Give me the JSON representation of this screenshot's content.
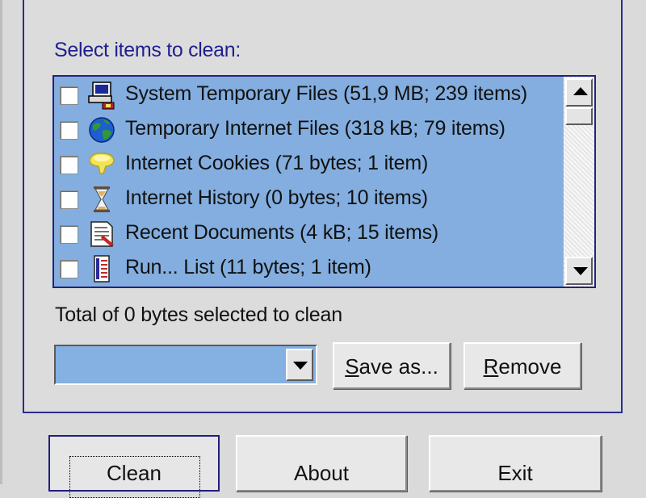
{
  "cleaner": {
    "section_label": "Select items to clean:",
    "items": [
      {
        "label": "System Temporary Files (51,9 MB; 239 items)",
        "icon": "computer-icon",
        "checked": false
      },
      {
        "label": "Temporary Internet Files (318 kB; 79 items)",
        "icon": "globe-icon",
        "checked": false
      },
      {
        "label": "Internet Cookies (71 bytes; 1 item)",
        "icon": "cookie-icon",
        "checked": false
      },
      {
        "label": "Internet History (0 bytes; 10 items)",
        "icon": "hourglass-icon",
        "checked": false
      },
      {
        "label": "Recent Documents (4 kB; 15 items)",
        "icon": "documents-icon",
        "checked": false
      },
      {
        "label": "Run... List (11 bytes; 1 item)",
        "icon": "run-list-icon",
        "checked": false
      }
    ],
    "total_text": "Total of 0 bytes selected to clean",
    "profile_value": "",
    "save_as": {
      "prefix": "S",
      "rest": "ave as..."
    },
    "remove": {
      "prefix": "R",
      "rest": "emove"
    }
  },
  "footer": {
    "clean_label": "Clean",
    "about_label": "About",
    "exit_label": "Exit"
  },
  "colors": {
    "selection_blue": "#83aedf",
    "frame_navy": "#2c2c8c",
    "label_blue": "#1f1f8f"
  }
}
